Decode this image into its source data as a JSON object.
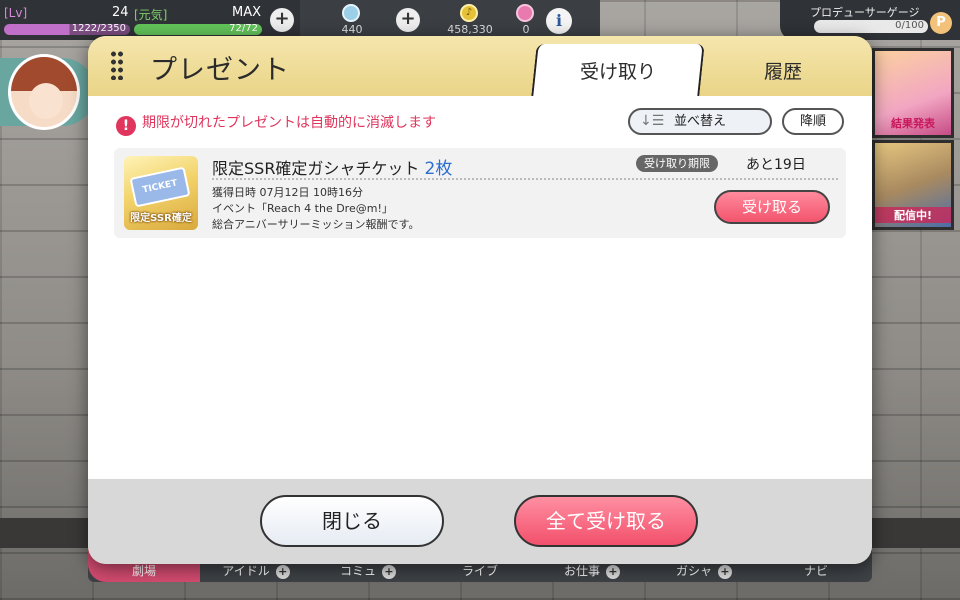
{
  "hud": {
    "lv_label": "[Lv]",
    "lv_value": "24",
    "exp_text": "1222/2350",
    "exp_progress": 0.52,
    "genki_label": "[元気]",
    "genki_max": "MAX",
    "genki_text": "72/72",
    "genki_progress": 1.0,
    "jewel_count": "440",
    "money": "458,330",
    "item_count": "0"
  },
  "producer_gauge": {
    "label": "プロデューサーゲージ",
    "value": "0/100",
    "icon": "P"
  },
  "banners": {
    "result": "結果発表",
    "streaming": "配信中!"
  },
  "tabbar": {
    "items": [
      "劇場",
      "アイドル",
      "コミュ",
      "ライブ",
      "お仕事",
      "ガシャ",
      "ナビ"
    ]
  },
  "modal": {
    "title": "プレゼント",
    "tabs": {
      "receive": "受け取り",
      "history": "履歴"
    },
    "notice": "期限が切れたプレゼントは自動的に消滅します",
    "sort_label": "並べ替え",
    "order_label": "降順",
    "items": [
      {
        "name": "限定SSR確定ガシャチケット",
        "count": "2枚",
        "thumb_label": "限定SSR確定",
        "ticket_text": "TICKET",
        "deadline_label": "受け取り期限",
        "deadline_remaining": "あと19日",
        "date": "獲得日時 07月12日 10時16分",
        "desc_line1": "イベント「Reach 4 the Dre@m!」",
        "desc_line2": "総合アニバーサリーミッション報酬です。",
        "receive_label": "受け取る"
      }
    ],
    "close_label": "閉じる",
    "receive_all_label": "全て受け取る"
  }
}
